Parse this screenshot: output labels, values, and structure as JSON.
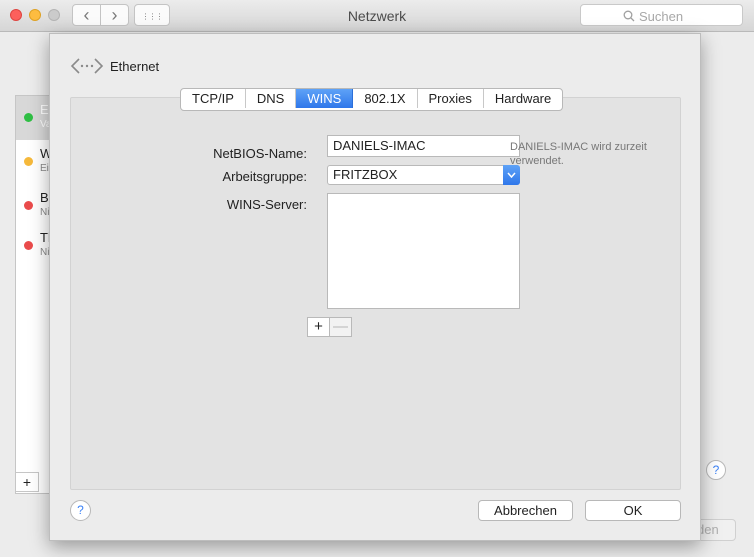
{
  "window": {
    "title": "Netzwerk"
  },
  "toolbar": {
    "back_glyph": "‹",
    "forward_glyph": "›",
    "grid_glyph": "⋮⋮⋮",
    "search_placeholder": "Suchen"
  },
  "background": {
    "services": [
      {
        "name": "E",
        "sub": "Va",
        "status_color": "#2fbf44"
      },
      {
        "name": "W",
        "sub": "Ei",
        "status_color": "#f6b93b"
      },
      {
        "name": "Bl",
        "sub": "Ni",
        "status_color": "#ea4b4b"
      },
      {
        "name": "Th",
        "sub": "Ni",
        "status_color": "#ea4b4b"
      }
    ],
    "add_glyph": "+",
    "help_glyph": "?",
    "apply_label": "den"
  },
  "sheet": {
    "header": {
      "icon": "ethernet-icon",
      "title": "Ethernet"
    },
    "tabs": [
      {
        "label": "TCP/IP",
        "active": false
      },
      {
        "label": "DNS",
        "active": false
      },
      {
        "label": "WINS",
        "active": true
      },
      {
        "label": "802.1X",
        "active": false
      },
      {
        "label": "Proxies",
        "active": false
      },
      {
        "label": "Hardware",
        "active": false
      }
    ],
    "form": {
      "netbios_label": "NetBIOS-Name:",
      "netbios_value": "DANIELS-IMAC",
      "netbios_hint": "DANIELS-IMAC wird zurzeit verwendet.",
      "workgroup_label": "Arbeitsgruppe:",
      "workgroup_value": "FRITZBOX",
      "wins_label": "WINS-Server:",
      "wins_servers": [],
      "add_glyph": "+",
      "remove_glyph": "—"
    },
    "footer": {
      "help_glyph": "?",
      "cancel_label": "Abbrechen",
      "ok_label": "OK"
    }
  },
  "colors": {
    "accent": "#2f77ea",
    "window_bg": "#ececec"
  }
}
